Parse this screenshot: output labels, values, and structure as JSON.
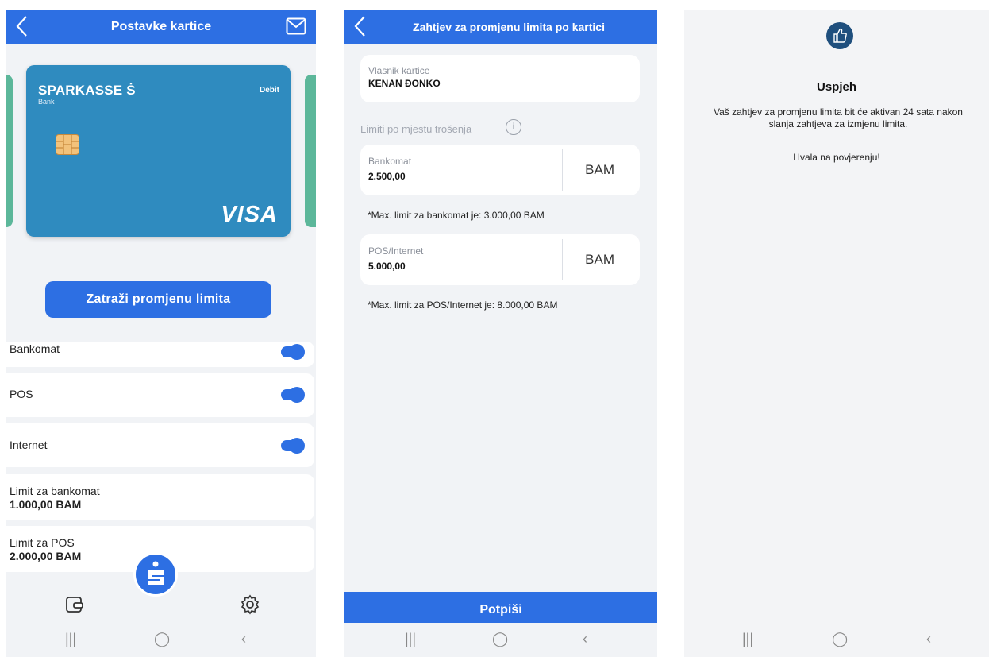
{
  "screen1": {
    "title": "Postavke kartice",
    "card": {
      "brand": "SPARKASSE",
      "brand_sub": "Bank",
      "type": "Debit",
      "network": "VISA"
    },
    "request_button": "Zatraži promjenu limita",
    "toggles": [
      {
        "label": "Bankomat",
        "on": true
      },
      {
        "label": "POS",
        "on": true
      },
      {
        "label": "Internet",
        "on": true
      }
    ],
    "limits": [
      {
        "label": "Limit za bankomat",
        "value": "1.000,00 BAM"
      },
      {
        "label": "Limit za POS",
        "value": "2.000,00 BAM"
      }
    ]
  },
  "screen2": {
    "title": "Zahtjev za promjenu limita po kartici",
    "owner_label": "Vlasnik kartice",
    "owner_value": "KENAN ĐONKO",
    "section_label": "Limiti po mjestu trošenja",
    "atm": {
      "label": "Bankomat",
      "value": "2.500,00",
      "currency": "BAM",
      "note": "*Max. limit za bankomat je: 3.000,00 BAM"
    },
    "pos": {
      "label": "POS/Internet",
      "value": "5.000,00",
      "currency": "BAM",
      "note": "*Max. limit za POS/Internet je: 8.000,00 BAM"
    },
    "sign_button": "Potpiši"
  },
  "screen3": {
    "title": "Uspjeh",
    "message_line1": "Vaš zahtjev za promjenu limita bit će aktivan 24 sata nakon",
    "message_line2": "slanja zahtjeva za izmjenu limita.",
    "thanks": "Hvala na povjerenju!"
  },
  "colors": {
    "accent": "#2d6fe3",
    "card_blue": "#2f8bbf",
    "card_green": "#5cb79a",
    "success_icon": "#1f4f7d"
  }
}
